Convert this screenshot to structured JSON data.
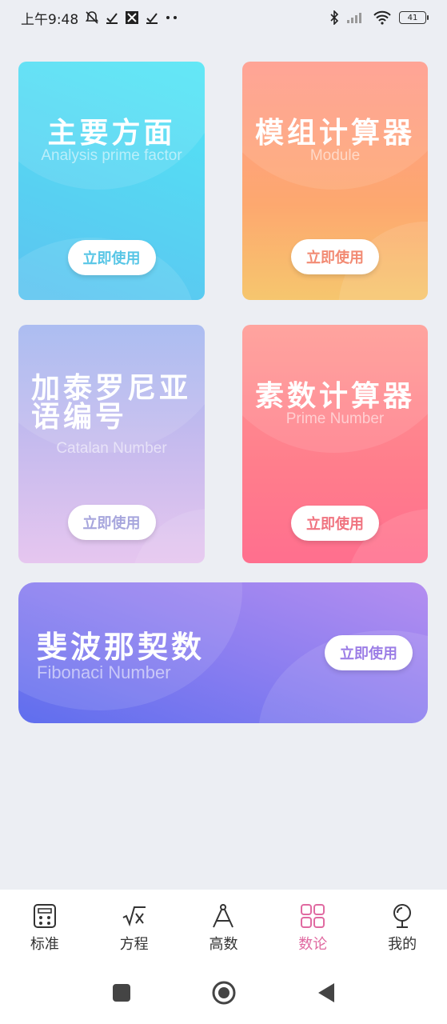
{
  "status_bar": {
    "time": "上午9:48",
    "battery": "41"
  },
  "cards": [
    {
      "title": "主要方面",
      "subtitle": "Analysis prime factor",
      "button": "立即使用"
    },
    {
      "title": "模组计算器",
      "subtitle": "Module",
      "button": "立即使用"
    },
    {
      "title_line1": "加泰罗尼亚",
      "title_line2": "语编号",
      "subtitle": "Catalan  Number",
      "button": "立即使用"
    },
    {
      "title": "素数计算器",
      "subtitle": "Prime Number",
      "button": "立即使用"
    },
    {
      "title": "斐波那契数",
      "subtitle": "Fibonaci  Number",
      "button": "立即使用"
    }
  ],
  "tabs": [
    {
      "label": "标准",
      "icon": "calculator-icon"
    },
    {
      "label": "方程",
      "icon": "sqrt-icon"
    },
    {
      "label": "高数",
      "icon": "compass-icon"
    },
    {
      "label": "数论",
      "icon": "grid-icon",
      "active": true
    },
    {
      "label": "我的",
      "icon": "profile-icon"
    }
  ],
  "colors": {
    "accent": "#e06aa1",
    "background": "#eceef3"
  }
}
